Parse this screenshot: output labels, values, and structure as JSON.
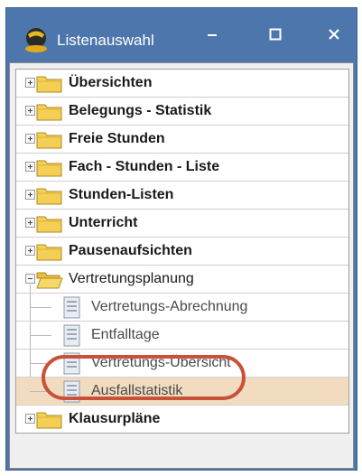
{
  "window": {
    "title": "Listenauswahl",
    "icon": "app-logo-icon",
    "controls": {
      "minimize": "minimize-icon",
      "maximize": "maximize-icon",
      "close": "close-icon"
    }
  },
  "tree": {
    "folders": [
      {
        "label": "Übersichten",
        "expanded": false
      },
      {
        "label": "Belegungs - Statistik",
        "expanded": false
      },
      {
        "label": "Freie Stunden",
        "expanded": false
      },
      {
        "label": "Fach - Stunden - Liste",
        "expanded": false
      },
      {
        "label": "Stunden-Listen",
        "expanded": false
      },
      {
        "label": "Unterricht",
        "expanded": false
      },
      {
        "label": "Pausenaufsichten",
        "expanded": false
      },
      {
        "label": "Vertretungsplanung",
        "expanded": true,
        "children": [
          {
            "label": "Vertretungs-Abrechnung",
            "selected": false
          },
          {
            "label": "Entfalltage",
            "selected": false
          },
          {
            "label": "Vertretungs-Übersicht",
            "selected": false
          },
          {
            "label": "Ausfallstatistik",
            "selected": true
          }
        ]
      },
      {
        "label": "Klausurpläne",
        "expanded": false
      }
    ]
  },
  "colors": {
    "titlebar": "#4d76ac",
    "selection": "#f2dcc0",
    "highlight_ring": "#c9513a"
  }
}
